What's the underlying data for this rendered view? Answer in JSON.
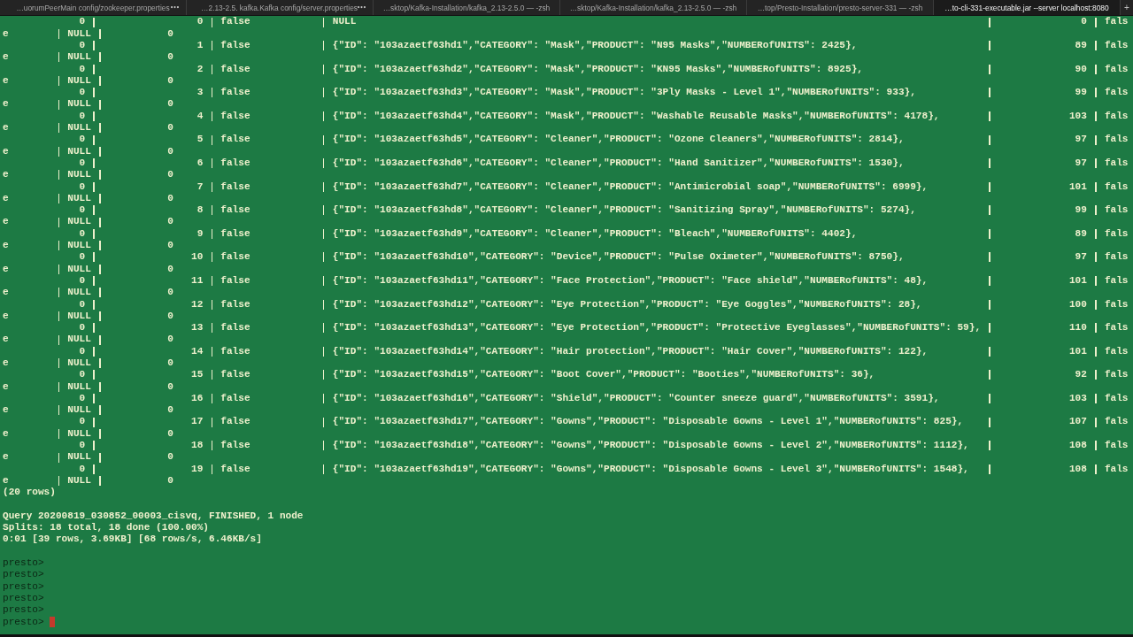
{
  "tabs": [
    {
      "title": "…uorumPeerMain config/zookeeper.properties",
      "selected": false,
      "busy": true
    },
    {
      "title": "…2.13-2.5. kafka.Kafka config/server.properties",
      "selected": false,
      "busy": true
    },
    {
      "title": "…sktop/Kafka-Installation/kafka_2.13-2.5.0 — -zsh",
      "selected": false,
      "busy": false
    },
    {
      "title": "…sktop/Kafka-Installation/kafka_2.13-2.5.0 — -zsh",
      "selected": false,
      "busy": false
    },
    {
      "title": "…top/Presto-Installation/presto-server-331 — -zsh",
      "selected": false,
      "busy": false
    },
    {
      "title": "…to-cli-331-executable.jar --server localhost:8080",
      "selected": true,
      "busy": false
    }
  ],
  "new_tab_button": "+",
  "result_rows": [
    {
      "leading_value": "0",
      "row_number": "0",
      "flag": "false",
      "payload": "NULL",
      "size": "0",
      "flag_start": "fals",
      "flag_end": "e",
      "null_value": "NULL",
      "last_value": "0"
    },
    {
      "leading_value": "0",
      "row_number": "1",
      "flag": "false",
      "payload": "{\"ID\": \"103azaetf63hd1\",\"CATEGORY\": \"Mask\",\"PRODUCT\": \"N95 Masks\",\"NUMBERofUNITS\": 2425},",
      "size": "89",
      "flag_start": "fals",
      "flag_end": "e",
      "null_value": "NULL",
      "last_value": "0"
    },
    {
      "leading_value": "0",
      "row_number": "2",
      "flag": "false",
      "payload": "{\"ID\": \"103azaetf63hd2\",\"CATEGORY\": \"Mask\",\"PRODUCT\": \"KN95 Masks\",\"NUMBERofUNITS\": 8925},",
      "size": "90",
      "flag_start": "fals",
      "flag_end": "e",
      "null_value": "NULL",
      "last_value": "0"
    },
    {
      "leading_value": "0",
      "row_number": "3",
      "flag": "false",
      "payload": "{\"ID\": \"103azaetf63hd3\",\"CATEGORY\": \"Mask\",\"PRODUCT\": \"3Ply Masks - Level 1\",\"NUMBERofUNITS\": 933},",
      "size": "99",
      "flag_start": "fals",
      "flag_end": "e",
      "null_value": "NULL",
      "last_value": "0"
    },
    {
      "leading_value": "0",
      "row_number": "4",
      "flag": "false",
      "payload": "{\"ID\": \"103azaetf63hd4\",\"CATEGORY\": \"Mask\",\"PRODUCT\": \"Washable Reusable Masks\",\"NUMBERofUNITS\": 4178},",
      "size": "103",
      "flag_start": "fals",
      "flag_end": "e",
      "null_value": "NULL",
      "last_value": "0"
    },
    {
      "leading_value": "0",
      "row_number": "5",
      "flag": "false",
      "payload": "{\"ID\": \"103azaetf63hd5\",\"CATEGORY\": \"Cleaner\",\"PRODUCT\": \"Ozone Cleaners\",\"NUMBERofUNITS\": 2814},",
      "size": "97",
      "flag_start": "fals",
      "flag_end": "e",
      "null_value": "NULL",
      "last_value": "0"
    },
    {
      "leading_value": "0",
      "row_number": "6",
      "flag": "false",
      "payload": "{\"ID\": \"103azaetf63hd6\",\"CATEGORY\": \"Cleaner\",\"PRODUCT\": \"Hand Sanitizer\",\"NUMBERofUNITS\": 1530},",
      "size": "97",
      "flag_start": "fals",
      "flag_end": "e",
      "null_value": "NULL",
      "last_value": "0"
    },
    {
      "leading_value": "0",
      "row_number": "7",
      "flag": "false",
      "payload": "{\"ID\": \"103azaetf63hd7\",\"CATEGORY\": \"Cleaner\",\"PRODUCT\": \"Antimicrobial soap\",\"NUMBERofUNITS\": 6999},",
      "size": "101",
      "flag_start": "fals",
      "flag_end": "e",
      "null_value": "NULL",
      "last_value": "0"
    },
    {
      "leading_value": "0",
      "row_number": "8",
      "flag": "false",
      "payload": "{\"ID\": \"103azaetf63hd8\",\"CATEGORY\": \"Cleaner\",\"PRODUCT\": \"Sanitizing Spray\",\"NUMBERofUNITS\": 5274},",
      "size": "99",
      "flag_start": "fals",
      "flag_end": "e",
      "null_value": "NULL",
      "last_value": "0"
    },
    {
      "leading_value": "0",
      "row_number": "9",
      "flag": "false",
      "payload": "{\"ID\": \"103azaetf63hd9\",\"CATEGORY\": \"Cleaner\",\"PRODUCT\": \"Bleach\",\"NUMBERofUNITS\": 4402},",
      "size": "89",
      "flag_start": "fals",
      "flag_end": "e",
      "null_value": "NULL",
      "last_value": "0"
    },
    {
      "leading_value": "0",
      "row_number": "10",
      "flag": "false",
      "payload": "{\"ID\": \"103azaetf63hd10\",\"CATEGORY\": \"Device\",\"PRODUCT\": \"Pulse Oximeter\",\"NUMBERofUNITS\": 8750},",
      "size": "97",
      "flag_start": "fals",
      "flag_end": "e",
      "null_value": "NULL",
      "last_value": "0"
    },
    {
      "leading_value": "0",
      "row_number": "11",
      "flag": "false",
      "payload": "{\"ID\": \"103azaetf63hd11\",\"CATEGORY\": \"Face Protection\",\"PRODUCT\": \"Face shield\",\"NUMBERofUNITS\": 48},",
      "size": "101",
      "flag_start": "fals",
      "flag_end": "e",
      "null_value": "NULL",
      "last_value": "0"
    },
    {
      "leading_value": "0",
      "row_number": "12",
      "flag": "false",
      "payload": "{\"ID\": \"103azaetf63hd12\",\"CATEGORY\": \"Eye Protection\",\"PRODUCT\": \"Eye Goggles\",\"NUMBERofUNITS\": 28},",
      "size": "100",
      "flag_start": "fals",
      "flag_end": "e",
      "null_value": "NULL",
      "last_value": "0"
    },
    {
      "leading_value": "0",
      "row_number": "13",
      "flag": "false",
      "payload": "{\"ID\": \"103azaetf63hd13\",\"CATEGORY\": \"Eye Protection\",\"PRODUCT\": \"Protective Eyeglasses\",\"NUMBERofUNITS\": 59},",
      "size": "110",
      "flag_start": "fals",
      "flag_end": "e",
      "null_value": "NULL",
      "last_value": "0"
    },
    {
      "leading_value": "0",
      "row_number": "14",
      "flag": "false",
      "payload": "{\"ID\": \"103azaetf63hd14\",\"CATEGORY\": \"Hair protection\",\"PRODUCT\": \"Hair Cover\",\"NUMBERofUNITS\": 122},",
      "size": "101",
      "flag_start": "fals",
      "flag_end": "e",
      "null_value": "NULL",
      "last_value": "0"
    },
    {
      "leading_value": "0",
      "row_number": "15",
      "flag": "false",
      "payload": "{\"ID\": \"103azaetf63hd15\",\"CATEGORY\": \"Boot Cover\",\"PRODUCT\": \"Booties\",\"NUMBERofUNITS\": 36},",
      "size": "92",
      "flag_start": "fals",
      "flag_end": "e",
      "null_value": "NULL",
      "last_value": "0"
    },
    {
      "leading_value": "0",
      "row_number": "16",
      "flag": "false",
      "payload": "{\"ID\": \"103azaetf63hd16\",\"CATEGORY\": \"Shield\",\"PRODUCT\": \"Counter sneeze guard\",\"NUMBERofUNITS\": 3591},",
      "size": "103",
      "flag_start": "fals",
      "flag_end": "e",
      "null_value": "NULL",
      "last_value": "0"
    },
    {
      "leading_value": "0",
      "row_number": "17",
      "flag": "false",
      "payload": "{\"ID\": \"103azaetf63hd17\",\"CATEGORY\": \"Gowns\",\"PRODUCT\": \"Disposable Gowns - Level 1\",\"NUMBERofUNITS\": 825},",
      "size": "107",
      "flag_start": "fals",
      "flag_end": "e",
      "null_value": "NULL",
      "last_value": "0"
    },
    {
      "leading_value": "0",
      "row_number": "18",
      "flag": "false",
      "payload": "{\"ID\": \"103azaetf63hd18\",\"CATEGORY\": \"Gowns\",\"PRODUCT\": \"Disposable Gowns - Level 2\",\"NUMBERofUNITS\": 1112},",
      "size": "108",
      "flag_start": "fals",
      "flag_end": "e",
      "null_value": "NULL",
      "last_value": "0"
    },
    {
      "leading_value": "0",
      "row_number": "19",
      "flag": "false",
      "payload": "{\"ID\": \"103azaetf63hd19\",\"CATEGORY\": \"Gowns\",\"PRODUCT\": \"Disposable Gowns - Level 3\",\"NUMBERofUNITS\": 1548},",
      "size": "108",
      "flag_start": "fals",
      "flag_end": "e",
      "null_value": "NULL",
      "last_value": "0"
    }
  ],
  "summary": {
    "row_count": "(20 rows)",
    "query_line": "Query 20200819_030852_00003_cisvq, FINISHED, 1 node",
    "splits_line": "Splits: 18 total, 18 done (100.00%)",
    "stats_line": "0:01 [39 rows, 3.69KB] [68 rows/s, 6.46KB/s]"
  },
  "prompts": [
    {
      "text": "presto>",
      "cursor": false
    },
    {
      "text": "presto>",
      "cursor": false
    },
    {
      "text": "presto>",
      "cursor": false
    },
    {
      "text": "presto>",
      "cursor": false
    },
    {
      "text": "presto>",
      "cursor": false
    },
    {
      "text": "presto>",
      "cursor": true
    }
  ]
}
